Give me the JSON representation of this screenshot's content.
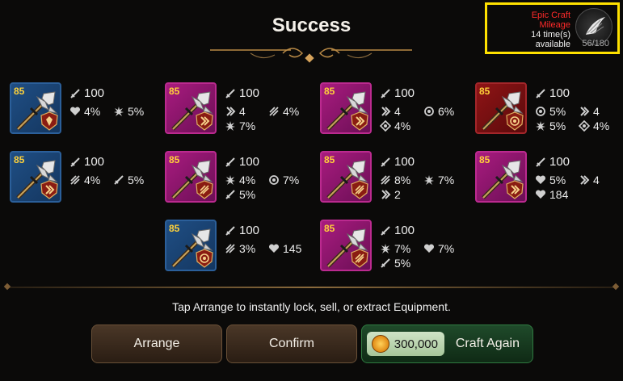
{
  "header": {
    "title": "Success",
    "mileage": {
      "label_line1": "Epic Craft",
      "label_line2": "Mileage",
      "times": "14 time(s)",
      "available": "available",
      "count": "56/180"
    }
  },
  "colors": {
    "highlight_box": "#ffe100",
    "mileage_label": "#ff2a2a",
    "grade_blue": "#1f4e84",
    "grade_purple": "#a81b7f",
    "grade_red": "#8f1416",
    "level_text": "#ffd23a"
  },
  "items": [
    {
      "level": "85",
      "grade": "blue",
      "set_icon": "shield-set-icon",
      "main": "100",
      "stats": [
        {
          "icon": "heart-icon",
          "value": "4%"
        },
        {
          "icon": "crit-burst-icon",
          "value": "5%"
        }
      ]
    },
    {
      "level": "85",
      "grade": "purple",
      "set_icon": "speed-set-icon",
      "main": "100",
      "stats": [
        {
          "icon": "speed-chevron-icon",
          "value": "4"
        },
        {
          "icon": "crit-damage-icon",
          "value": "4%"
        },
        {
          "icon": "crit-burst-icon",
          "value": "7%"
        }
      ]
    },
    {
      "level": "85",
      "grade": "purple",
      "set_icon": "speed-set-icon",
      "main": "100",
      "stats": [
        {
          "icon": "speed-chevron-icon",
          "value": "4"
        },
        {
          "icon": "effectiveness-icon",
          "value": "6%"
        },
        {
          "icon": "effect-resist-icon",
          "value": "4%"
        }
      ]
    },
    {
      "level": "85",
      "grade": "red",
      "set_icon": "hit-set-icon",
      "main": "100",
      "stats": [
        {
          "icon": "effectiveness-icon",
          "value": "5%"
        },
        {
          "icon": "speed-chevron-icon",
          "value": "4"
        },
        {
          "icon": "crit-burst-icon",
          "value": "5%"
        },
        {
          "icon": "effect-resist-icon",
          "value": "4%"
        }
      ]
    },
    {
      "level": "85",
      "grade": "blue",
      "set_icon": "speed-set-icon",
      "main": "100",
      "stats": [
        {
          "icon": "crit-damage-icon",
          "value": "4%"
        },
        {
          "icon": "attack-sword-icon",
          "value": "5%"
        }
      ]
    },
    {
      "level": "85",
      "grade": "purple",
      "set_icon": "crit-set-icon",
      "main": "100",
      "stats": [
        {
          "icon": "crit-burst-icon",
          "value": "4%"
        },
        {
          "icon": "effectiveness-icon",
          "value": "7%"
        },
        {
          "icon": "attack-sword-icon",
          "value": "5%"
        }
      ]
    },
    {
      "level": "85",
      "grade": "purple",
      "set_icon": "crit-set-icon",
      "main": "100",
      "stats": [
        {
          "icon": "crit-damage-icon",
          "value": "8%"
        },
        {
          "icon": "crit-burst-icon",
          "value": "7%"
        },
        {
          "icon": "speed-chevron-icon",
          "value": "2"
        }
      ]
    },
    {
      "level": "85",
      "grade": "purple",
      "set_icon": "speed-set-icon",
      "main": "100",
      "stats": [
        {
          "icon": "heart-icon",
          "value": "5%"
        },
        {
          "icon": "speed-chevron-icon",
          "value": "4"
        },
        {
          "icon": "heart-icon",
          "value": "184"
        }
      ]
    },
    {
      "level": "85",
      "grade": "blue",
      "set_icon": "hit-set-icon",
      "main": "100",
      "stats": [
        {
          "icon": "crit-damage-icon",
          "value": "3%"
        },
        {
          "icon": "heart-icon",
          "value": "145"
        }
      ]
    },
    {
      "level": "85",
      "grade": "purple",
      "set_icon": "crit-set-icon",
      "main": "100",
      "stats": [
        {
          "icon": "crit-burst-icon",
          "value": "7%"
        },
        {
          "icon": "heart-icon",
          "value": "7%"
        },
        {
          "icon": "attack-sword-icon",
          "value": "5%"
        }
      ]
    }
  ],
  "footer": {
    "hint": "Tap Arrange to instantly lock, sell, or extract Equipment.",
    "arrange_label": "Arrange",
    "confirm_label": "Confirm",
    "craft_cost": "300,000",
    "craft_again_label": "Craft Again"
  }
}
